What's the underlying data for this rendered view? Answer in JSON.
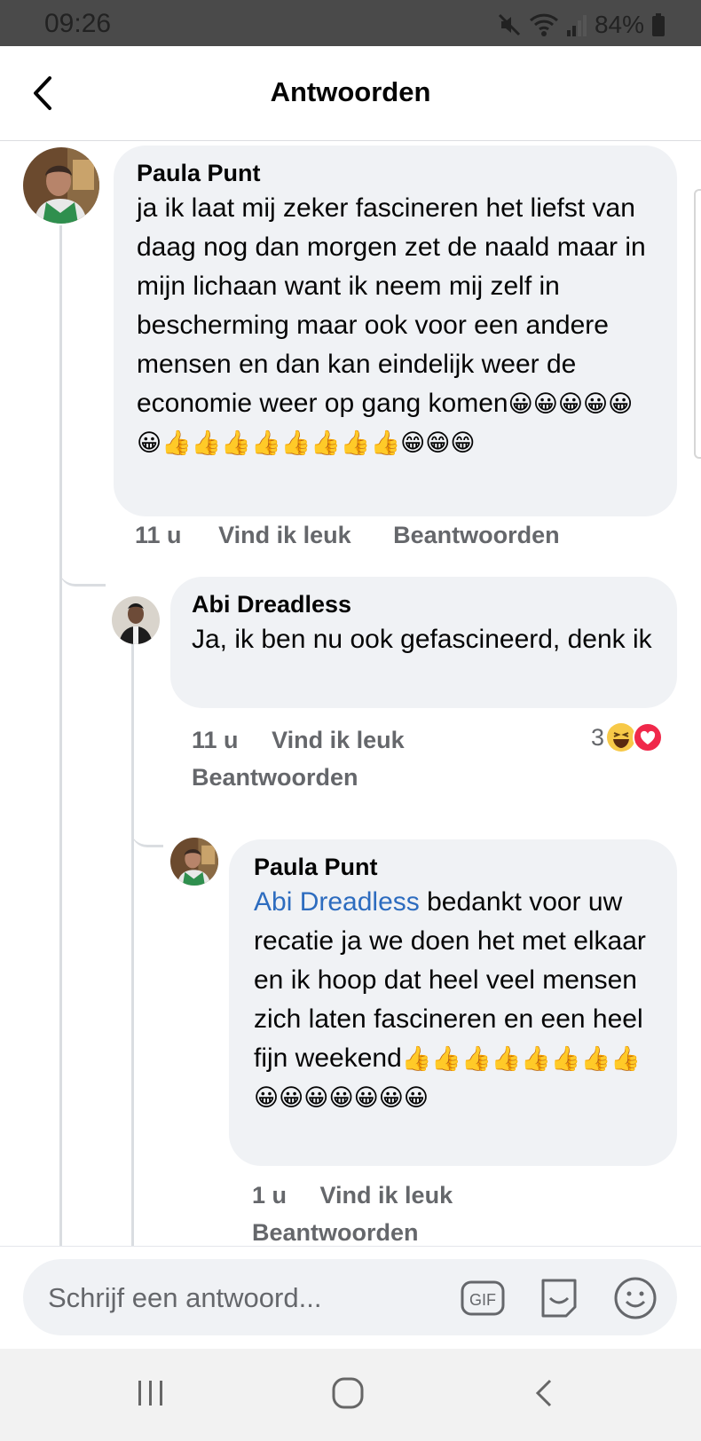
{
  "status_bar": {
    "time": "09:26",
    "battery": "84%"
  },
  "header": {
    "title": "Antwoorden"
  },
  "comments": [
    {
      "author": "Paula Punt",
      "text": "ja ik laat mij zeker fascineren het liefst van daag nog dan morgen zet de naald maar in mijn lichaan want ik neem mij zelf in bescherming maar ook voor een andere mensen en dan kan eindelijk weer de economie weer op gang komen",
      "emojis": "😀😀😀😀😀😀👍👍👍👍👍👍👍👍😁😁😁",
      "time": "11 u",
      "like_label": "Vind ik leuk",
      "reply_label": "Beantwoorden"
    },
    {
      "author": "Abi Dreadless",
      "text": "Ja, ik ben nu ook gefascineerd, denk ik",
      "time": "11 u",
      "like_label": "Vind ik leuk",
      "reply_label": "Beantwoorden",
      "reaction_count": "3"
    },
    {
      "author": "Paula Punt",
      "mention": "Abi Dreadless",
      "text": "bedankt voor uw recatie ja we doen het met elkaar en ik hoop dat heel veel mensen zich laten fascineren en een heel fijn weekend",
      "emojis": "👍👍👍👍👍👍👍👍😀😀😀😀😀😀😀",
      "time": "1 u",
      "like_label": "Vind ik leuk",
      "reply_label": "Beantwoorden"
    }
  ],
  "composer": {
    "placeholder": "Schrijf een antwoord...",
    "gif_label": "GIF"
  },
  "icons": [
    "back-arrow-icon",
    "mute-icon",
    "wifi-icon",
    "signal-icon",
    "battery-icon",
    "gif-icon",
    "sticker-icon",
    "emoji-icon",
    "recents-icon",
    "home-icon",
    "back-icon",
    "haha-reaction-icon",
    "love-reaction-icon"
  ],
  "colors": {
    "bubble": "#f0f2f5",
    "mention": "#2d6cbf",
    "meta": "#65676b"
  }
}
